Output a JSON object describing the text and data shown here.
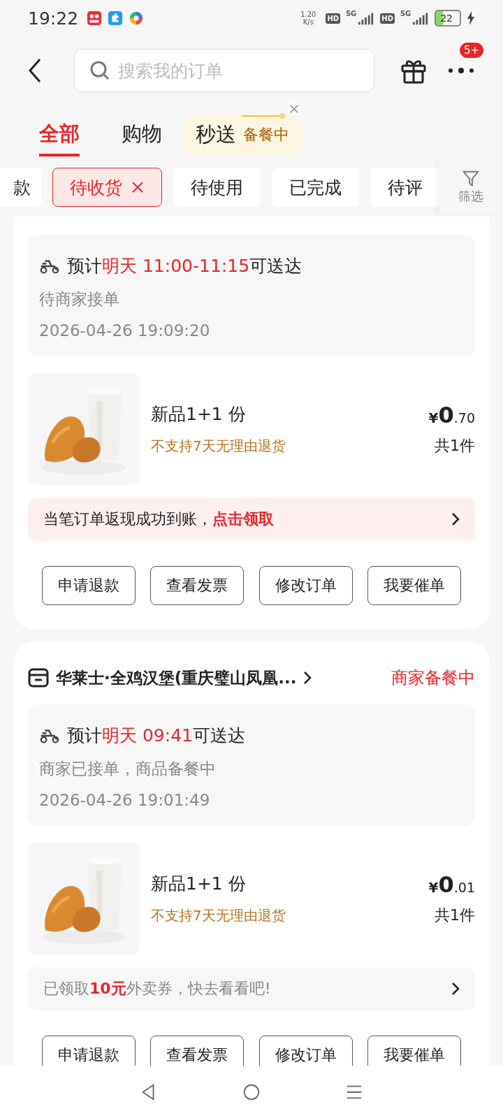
{
  "status_bar": {
    "time": "19:22",
    "network_speed": "1.20",
    "speed_unit": "K/s",
    "sims": [
      {
        "hd": "HD",
        "network": "5G"
      },
      {
        "hd": "HD",
        "network": "5G"
      }
    ],
    "battery": "22"
  },
  "search": {
    "placeholder": "搜索我的订单"
  },
  "more_badge": "5+",
  "tabs": [
    {
      "label": "全部",
      "selected": true
    },
    {
      "label": "购物",
      "selected": false
    },
    {
      "label": "秒送",
      "selected": false,
      "status": "备餐中"
    }
  ],
  "filters": [
    {
      "label": "款",
      "selected": false
    },
    {
      "label": "待收货",
      "selected": true
    },
    {
      "label": "待使用",
      "selected": false
    },
    {
      "label": "已完成",
      "selected": false
    },
    {
      "label": "待评",
      "selected": false
    }
  ],
  "filter_button": "筛选",
  "orders": [
    {
      "eta_prefix": "预计",
      "eta_highlight": "明天 11:00-11:15",
      "eta_suffix": "可送达",
      "progress": "待商家接单",
      "time": "2026-04-26 19:09:20",
      "product": {
        "name": "新品1+1 份",
        "note": "不支持7天无理由退货",
        "currency": "¥",
        "price_int": "0",
        "price_dec": ".70",
        "count": "共1件"
      },
      "promo": {
        "kind": "cashback",
        "text": "当笔订单返现成功到账，**点击领取**"
      },
      "actions": [
        "申请退款",
        "查看发票",
        "修改订单",
        "我要催单"
      ]
    },
    {
      "store": "华莱士·全鸡汉堡(重庆璧山凤凰...",
      "status": "商家备餐中",
      "eta_prefix": "预计",
      "eta_highlight": "明天 09:41",
      "eta_suffix": "可送达",
      "progress": "商家已接单，商品备餐中",
      "time": "2026-04-26 19:01:49",
      "product": {
        "name": "新品1+1 份",
        "note": "不支持7天无理由退货",
        "currency": "¥",
        "price_int": "0",
        "price_dec": ".01",
        "count": "共1件"
      },
      "promo": {
        "kind": "coupon",
        "text": "已领取**10元**外卖券，快去看看吧!"
      },
      "actions": [
        "申请退款",
        "查看发票",
        "修改订单",
        "我要催单"
      ]
    }
  ]
}
